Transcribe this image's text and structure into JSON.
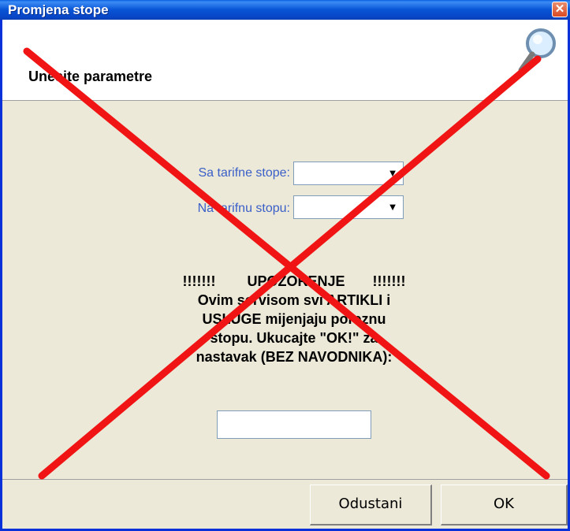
{
  "window": {
    "title": "Promjena stope"
  },
  "header": {
    "subtitle": "Unesite parametre"
  },
  "form": {
    "from_label": "Sa tarifne stope:",
    "to_label": "Na tarifnu stopu:",
    "from_value": "",
    "to_value": ""
  },
  "warning": {
    "heading": "!!!!!!!        UPOZORENJE       !!!!!!!",
    "line1": "Ovim servisom svi ARTIKLI i",
    "line2": "USLUGE mijenjaju poreznu",
    "line3": "stopu. Ukucajte \"OK!\" za",
    "line4": "nastavak (BEZ NAVODNIKA):"
  },
  "confirm_input": {
    "value": ""
  },
  "buttons": {
    "cancel_label": "Odustani",
    "ok_label": "OK"
  },
  "colors": {
    "titlebar": "#0854d6",
    "dialog_bg": "#ece9d8",
    "label_blue": "#3a5fc8",
    "overlay_red": "#f01414"
  },
  "icons": {
    "close": "close-icon",
    "magnifier": "magnifier-icon",
    "dropdown": "chevron-down-icon"
  }
}
